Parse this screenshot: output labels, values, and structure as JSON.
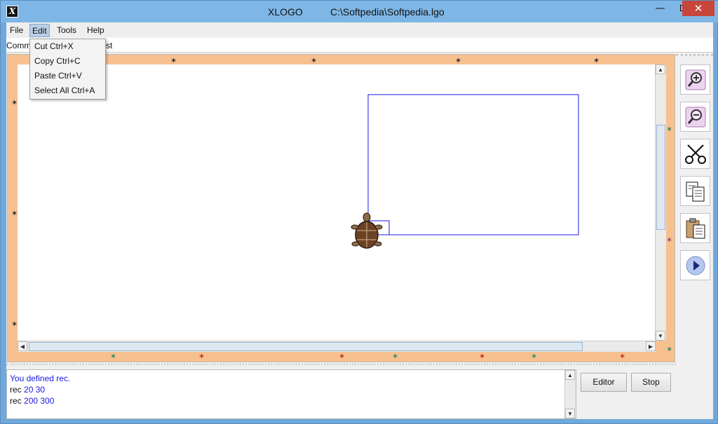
{
  "titlebar": {
    "app": "XLOGO",
    "file": "C:\\Softpedia\\Softpedia.lgo",
    "minimize": "—",
    "close": "✕"
  },
  "menubar": {
    "file": "File",
    "edit": "Edit",
    "tools": "Tools",
    "help": "Help"
  },
  "edit_menu": {
    "items": [
      {
        "label": "Cut Ctrl+X"
      },
      {
        "label": "Copy Ctrl+C"
      },
      {
        "label": "Paste Ctrl+V"
      },
      {
        "label": "Select All Ctrl+A"
      }
    ]
  },
  "command": {
    "label_left": "Comm",
    "label_right": "st"
  },
  "toolbar": {
    "icons": [
      "zoom-in-icon",
      "zoom-out-icon",
      "scissors-icon",
      "copy-icon",
      "paste-icon",
      "play-icon"
    ]
  },
  "history": {
    "lines": [
      {
        "text": "You defined rec.",
        "color": "#1a1ae0"
      },
      {
        "prefix": "rec ",
        "args": "20 30"
      },
      {
        "prefix": "rec ",
        "args": "200 300"
      }
    ]
  },
  "buttons": {
    "editor": "Editor",
    "stop": "Stop"
  },
  "colors": {
    "canvas_border": "#f6c08f",
    "pen": "#1a1ae0",
    "title_bar": "#7eb6e6",
    "close": "#c7463c"
  }
}
